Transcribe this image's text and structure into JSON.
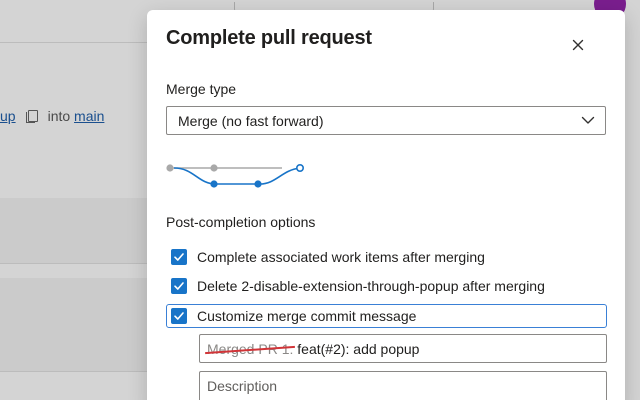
{
  "background": {
    "branch_source_fragment": "up",
    "into_label": "into",
    "target_branch": "main"
  },
  "dialog": {
    "title": "Complete pull request",
    "merge_type": {
      "label": "Merge type",
      "selected": "Merge (no fast forward)"
    },
    "post_completion": {
      "label": "Post-completion options",
      "options": [
        {
          "label": "Complete associated work items after merging",
          "checked": true
        },
        {
          "label": "Delete 2-disable-extension-through-popup after merging",
          "checked": true
        },
        {
          "label": "Customize merge commit message",
          "checked": true
        }
      ]
    },
    "commit_message": {
      "struck_prefix": "Merged PR 1:",
      "value": " feat(#2): add popup"
    },
    "description": {
      "placeholder": "Description"
    }
  },
  "colors": {
    "accent": "#1874c8",
    "focus_border": "#3a80d6",
    "strike": "#d13438",
    "graph_gray": "#a9a9a9",
    "graph_blue": "#1874c8"
  }
}
